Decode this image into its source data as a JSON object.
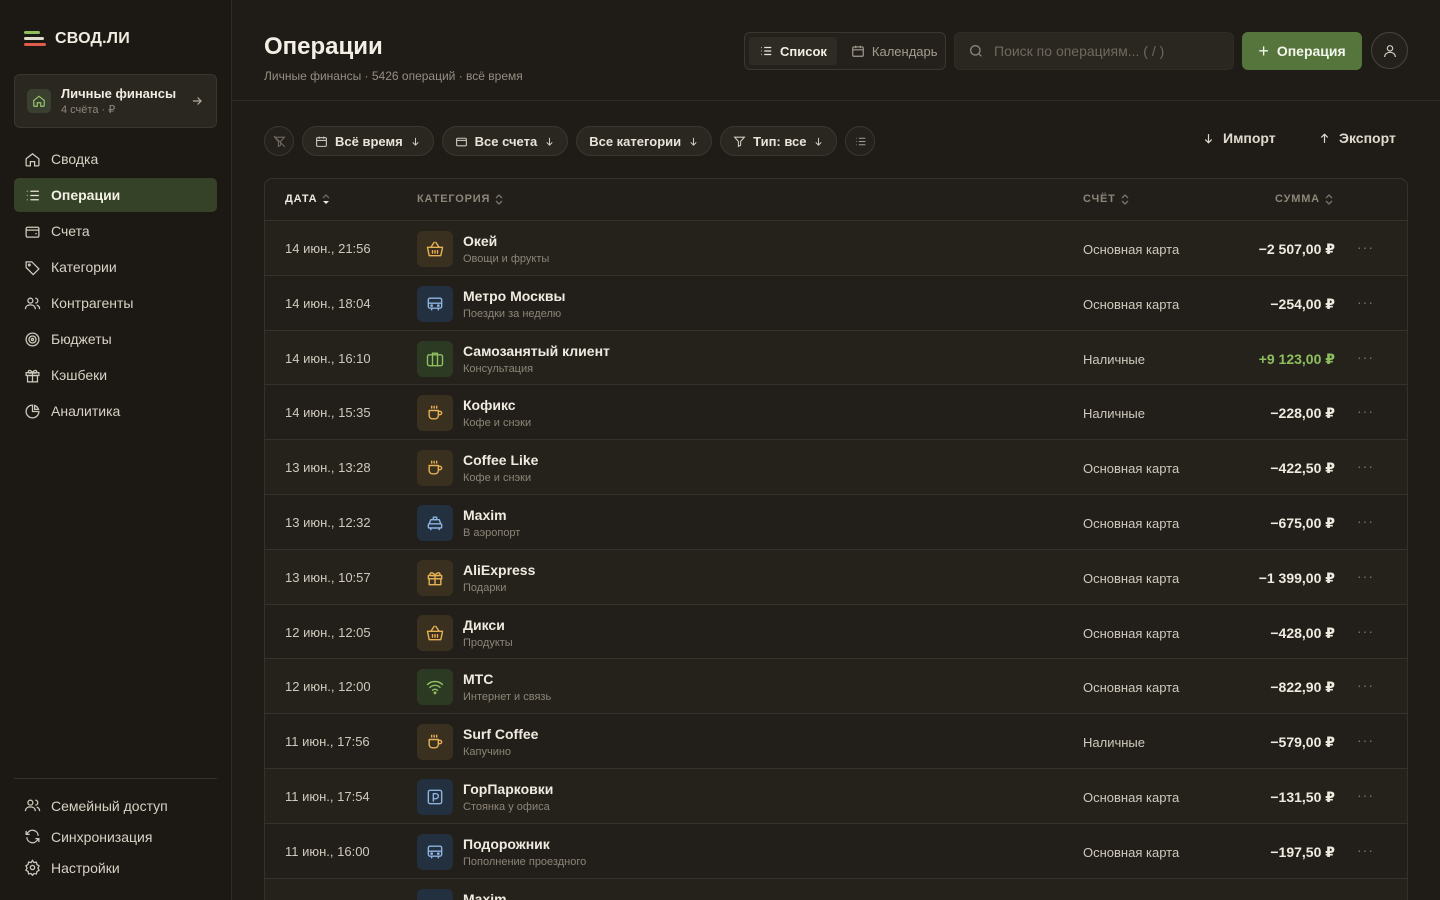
{
  "app": {
    "name": "СВОД.ЛИ"
  },
  "workspace": {
    "title": "Личные финансы",
    "subtitle": "4 счёта · ₽"
  },
  "nav": [
    {
      "label": "Сводка",
      "icon": "home-icon"
    },
    {
      "label": "Операции",
      "icon": "list-icon",
      "active": true
    },
    {
      "label": "Счета",
      "icon": "wallet-icon"
    },
    {
      "label": "Категории",
      "icon": "tag-icon"
    },
    {
      "label": "Контрагенты",
      "icon": "users-icon"
    },
    {
      "label": "Бюджеты",
      "icon": "target-icon"
    },
    {
      "label": "Кэшбеки",
      "icon": "gift-icon"
    },
    {
      "label": "Аналитика",
      "icon": "pie-chart-icon"
    }
  ],
  "nav_bottom": [
    {
      "label": "Семейный доступ",
      "icon": "users-icon"
    },
    {
      "label": "Синхронизация",
      "icon": "sync-icon"
    },
    {
      "label": "Настройки",
      "icon": "gear-icon"
    }
  ],
  "header": {
    "title": "Операции",
    "subtitle": "Личные финансы · 5426 операций · всё время",
    "view_list": "Список",
    "view_calendar": "Календарь",
    "search_placeholder": "Поиск по операциям... ( / )",
    "add_label": "Операция"
  },
  "filters": {
    "period": "Всё время",
    "accounts": "Все счета",
    "categories": "Все категории",
    "type": "Тип: все",
    "import": "Импорт",
    "export": "Экспорт"
  },
  "table": {
    "columns": {
      "date": "ДАТА",
      "category": "КАТЕГОРИЯ",
      "account": "СЧЁТ",
      "amount": "СУММА"
    },
    "rows": [
      {
        "date": "14 июн., 21:56",
        "merchant": "Окей",
        "note": "Овощи и фрукты",
        "account": "Основная карта",
        "amount": "−2 507,00 ₽",
        "icon": "basket-icon",
        "tone": "amber"
      },
      {
        "date": "14 июн., 18:04",
        "merchant": "Метро Москвы",
        "note": "Поездки за неделю",
        "account": "Основная карта",
        "amount": "−254,00 ₽",
        "icon": "bus-icon",
        "tone": "blue"
      },
      {
        "date": "14 июн., 16:10",
        "merchant": "Самозанятый клиент",
        "note": "Консультация",
        "account": "Наличные",
        "amount": "+9 123,00 ₽",
        "icon": "briefcase-icon",
        "tone": "green",
        "income": true
      },
      {
        "date": "14 июн., 15:35",
        "merchant": "Кофикс",
        "note": "Кофе и снэки",
        "account": "Наличные",
        "amount": "−228,00 ₽",
        "icon": "coffee-icon",
        "tone": "amber"
      },
      {
        "date": "13 июн., 13:28",
        "merchant": "Coffee Like",
        "note": "Кофе и снэки",
        "account": "Основная карта",
        "amount": "−422,50 ₽",
        "icon": "coffee-icon",
        "tone": "amber"
      },
      {
        "date": "13 июн., 12:32",
        "merchant": "Maxim",
        "note": "В аэропорт",
        "account": "Основная карта",
        "amount": "−675,00 ₽",
        "icon": "taxi-icon",
        "tone": "blue"
      },
      {
        "date": "13 июн., 10:57",
        "merchant": "AliExpress",
        "note": "Подарки",
        "account": "Основная карта",
        "amount": "−1 399,00 ₽",
        "icon": "gift-icon",
        "tone": "amber"
      },
      {
        "date": "12 июн., 12:05",
        "merchant": "Дикси",
        "note": "Продукты",
        "account": "Основная карта",
        "amount": "−428,00 ₽",
        "icon": "basket-icon",
        "tone": "amber"
      },
      {
        "date": "12 июн., 12:00",
        "merchant": "МТС",
        "note": "Интернет и связь",
        "account": "Основная карта",
        "amount": "−822,90 ₽",
        "icon": "wifi-icon",
        "tone": "green"
      },
      {
        "date": "11 июн., 17:56",
        "merchant": "Surf Coffee",
        "note": "Капучино",
        "account": "Наличные",
        "amount": "−579,00 ₽",
        "icon": "coffee-icon",
        "tone": "amber"
      },
      {
        "date": "11 июн., 17:54",
        "merchant": "ГорПарковки",
        "note": "Стоянка у офиса",
        "account": "Основная карта",
        "amount": "−131,50 ₽",
        "icon": "parking-icon",
        "tone": "blue"
      },
      {
        "date": "11 июн., 16:00",
        "merchant": "Подорожник",
        "note": "Пополнение проездного",
        "account": "Основная карта",
        "amount": "−197,50 ₽",
        "icon": "bus-icon",
        "tone": "blue"
      },
      {
        "date": "",
        "merchant": "Maxim",
        "note": "",
        "account": "",
        "amount": "",
        "icon": "taxi-icon",
        "tone": "blue"
      }
    ]
  },
  "colors": {
    "accent": "#55753c",
    "income": "#8fbf5d",
    "background": "#1f1c18"
  }
}
